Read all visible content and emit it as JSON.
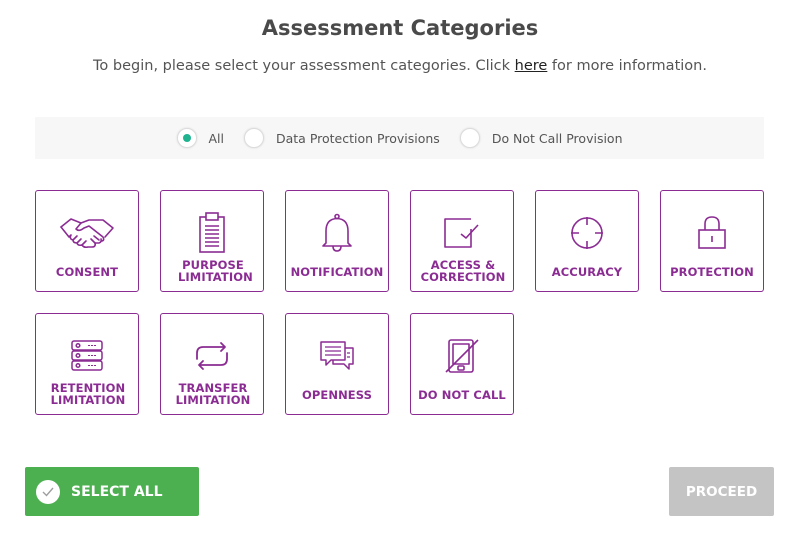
{
  "header": {
    "title": "Assessment Categories",
    "subtitle_before": "To begin, please select your assessment categories. Click ",
    "subtitle_link": "here",
    "subtitle_after": " for more information."
  },
  "filter": {
    "selected": "All",
    "options": [
      {
        "label": "All",
        "checked": true
      },
      {
        "label": "Data Protection Provisions",
        "checked": false
      },
      {
        "label": "Do Not Call Provision",
        "checked": false
      }
    ]
  },
  "categories": [
    {
      "label": "CONSENT",
      "icon": "handshake-icon"
    },
    {
      "label": "PURPOSE LIMITATION",
      "icon": "clipboard-icon"
    },
    {
      "label": "NOTIFICATION",
      "icon": "bell-icon"
    },
    {
      "label": "ACCESS & CORRECTION",
      "icon": "checkbox-icon"
    },
    {
      "label": "ACCURACY",
      "icon": "crosshair-icon"
    },
    {
      "label": "PROTECTION",
      "icon": "lock-icon"
    },
    {
      "label": "RETENTION LIMITATION",
      "icon": "server-icon"
    },
    {
      "label": "TRANSFER LIMITATION",
      "icon": "transfer-arrows-icon"
    },
    {
      "label": "OPENNESS",
      "icon": "chat-bubbles-icon"
    },
    {
      "label": "DO NOT CALL",
      "icon": "no-phone-icon"
    }
  ],
  "actions": {
    "select_all": "SELECT ALL",
    "proceed": "PROCEED"
  },
  "colors": {
    "accent": "#8b2c93",
    "radio_checked": "#1fb28f",
    "select_all_bg": "#4caf50",
    "proceed_disabled_bg": "#c4c4c4"
  }
}
